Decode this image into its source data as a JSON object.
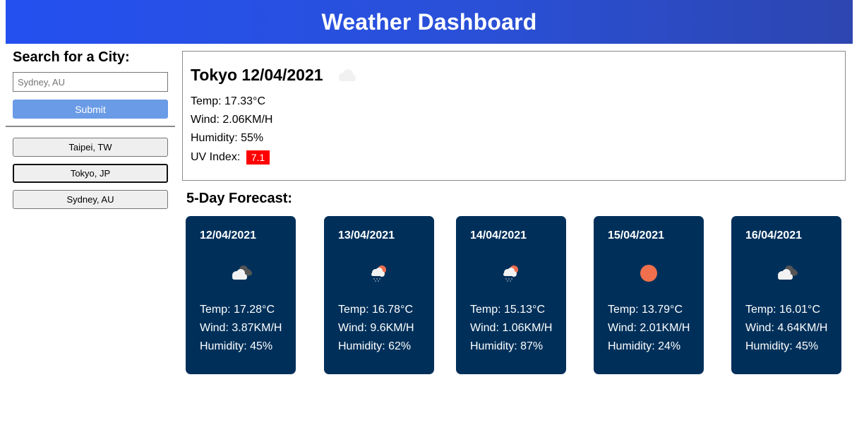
{
  "header": {
    "title": "Weather Dashboard"
  },
  "search": {
    "heading": "Search for a City:",
    "placeholder": "Sydney, AU",
    "submit_label": "Submit"
  },
  "history": [
    "Taipei, TW",
    "Tokyo, JP",
    "Sydney, AU"
  ],
  "history_active": "Tokyo, JP",
  "current": {
    "title": "Tokyo 12/04/2021",
    "icon": "cloud-icon",
    "temp": "Temp: 17.33°C",
    "wind": "Wind: 2.06KM/H",
    "humidity": "Humidity: 55%",
    "uv_label": "UV Index:",
    "uv_value": "7.1",
    "uv_color": "#ff0000"
  },
  "forecast": {
    "heading": "5-Day Forecast:",
    "days": [
      {
        "date": "12/04/2021",
        "icon": "broken-clouds-icon",
        "temp": "Temp: 17.28°C",
        "wind": "Wind: 3.87KM/H",
        "humidity": "Humidity: 45%"
      },
      {
        "date": "13/04/2021",
        "icon": "rain-sun-icon",
        "temp": "Temp: 16.78°C",
        "wind": "Wind: 9.6KM/H",
        "humidity": "Humidity: 62%"
      },
      {
        "date": "14/04/2021",
        "icon": "rain-sun-icon",
        "temp": "Temp: 15.13°C",
        "wind": "Wind: 1.06KM/H",
        "humidity": "Humidity: 87%"
      },
      {
        "date": "15/04/2021",
        "icon": "sun-icon",
        "temp": "Temp: 13.79°C",
        "wind": "Wind: 2.01KM/H",
        "humidity": "Humidity: 24%"
      },
      {
        "date": "16/04/2021",
        "icon": "broken-clouds-icon",
        "temp": "Temp: 16.01°C",
        "wind": "Wind: 4.64KM/H",
        "humidity": "Humidity: 45%"
      }
    ]
  },
  "colors": {
    "header": "#2a50d8",
    "submit": "#6a9be6",
    "card": "#00305a",
    "sun": "#f0704e"
  }
}
